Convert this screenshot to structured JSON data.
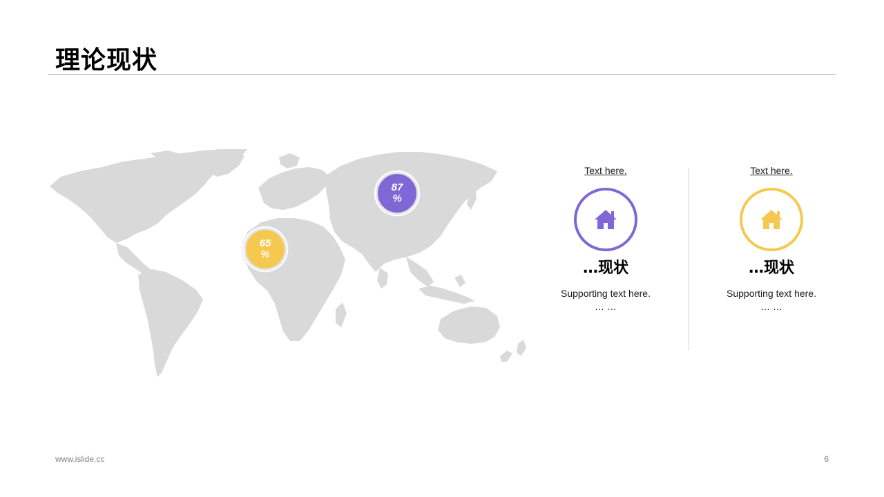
{
  "slide": {
    "title": "理论现状",
    "page_number": "6",
    "footer_url": "www.islide.cc"
  },
  "map": {
    "stats": [
      {
        "value_line1": "87",
        "value_line2": "%",
        "color": "#7f67d5"
      },
      {
        "value_line1": "65",
        "value_line2": "%",
        "color": "#f5c94f"
      }
    ]
  },
  "cards": [
    {
      "heading": "Text here.",
      "icon": "house-icon",
      "color": "#7f67d5",
      "label": "…现状",
      "body_line1": "Supporting  text here.",
      "body_line2": "… …"
    },
    {
      "heading": "Text here.",
      "icon": "house-icon",
      "color": "#f5c94f",
      "label": "…现状",
      "body_line1": "Supporting  text here.",
      "body_line2": "… …"
    }
  ]
}
